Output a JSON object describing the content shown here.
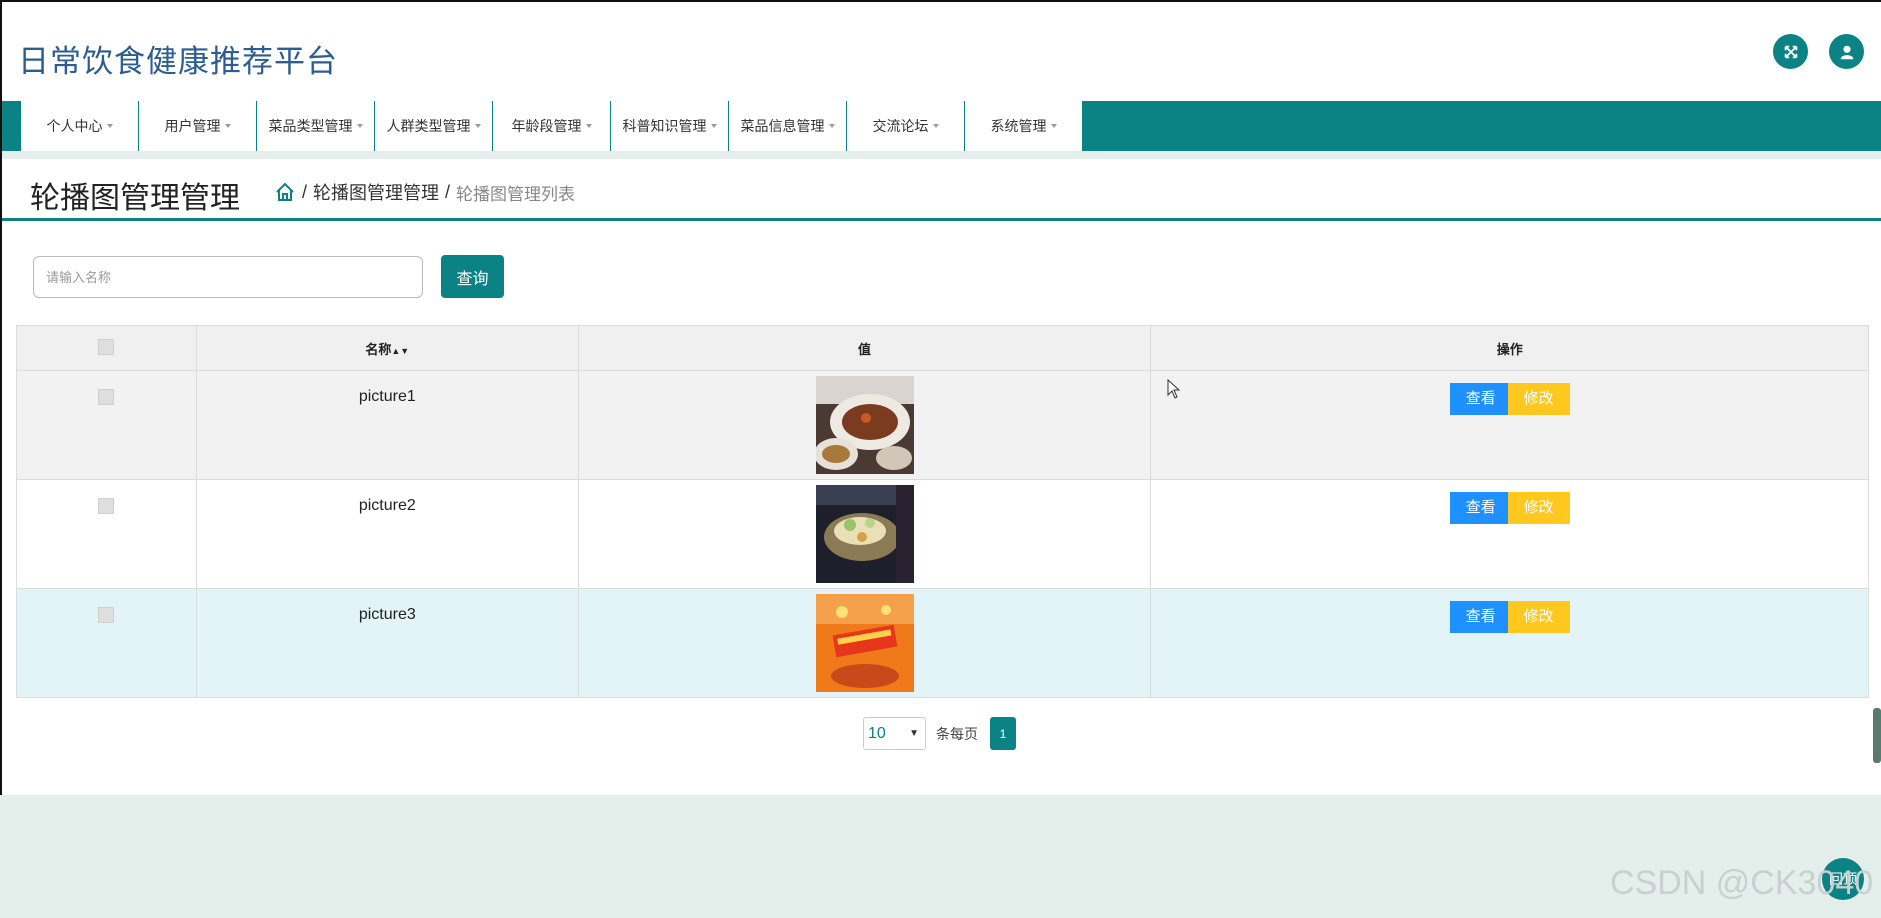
{
  "header": {
    "site_title": "日常饮食健康推荐平台",
    "fullscreen_icon": "expand-arrows-icon",
    "user_icon": "user-icon"
  },
  "nav": {
    "items": [
      {
        "label": "个人中心"
      },
      {
        "label": "用户管理"
      },
      {
        "label": "菜品类型管理"
      },
      {
        "label": "人群类型管理"
      },
      {
        "label": "年龄段管理"
      },
      {
        "label": "科普知识管理"
      },
      {
        "label": "菜品信息管理"
      },
      {
        "label": "交流论坛"
      },
      {
        "label": "系统管理"
      }
    ]
  },
  "page": {
    "title": "轮播图管理管理",
    "breadcrumb": {
      "home_icon": "home-icon",
      "sep1": "/",
      "section": "轮播图管理管理",
      "sep2": "/",
      "current": "轮播图管理列表"
    }
  },
  "search": {
    "placeholder": "请输入名称",
    "value": "",
    "button_label": "查询"
  },
  "table": {
    "headers": {
      "name": "名称",
      "value": "值",
      "actions": "操作"
    },
    "sort_icon": "sort-arrows-icon",
    "rows": [
      {
        "name": "picture1",
        "image": "food-dish-photo-1",
        "view": "查看",
        "edit": "修改"
      },
      {
        "name": "picture2",
        "image": "food-dish-photo-2",
        "view": "查看",
        "edit": "修改"
      },
      {
        "name": "picture3",
        "image": "promo-banner-photo-3",
        "view": "查看",
        "edit": "修改"
      }
    ]
  },
  "pagination": {
    "page_size": "10",
    "per_page_label": "条每页",
    "current_page": "1"
  },
  "overlay": {
    "watermark": "CSDN @CK3040",
    "float_button": "回顶"
  },
  "colors": {
    "primary": "#0b8385",
    "title_blue": "#2b5c92",
    "view_button": "#1e90ff",
    "edit_button": "#ffc81e",
    "page_bg": "#e4efeb"
  }
}
